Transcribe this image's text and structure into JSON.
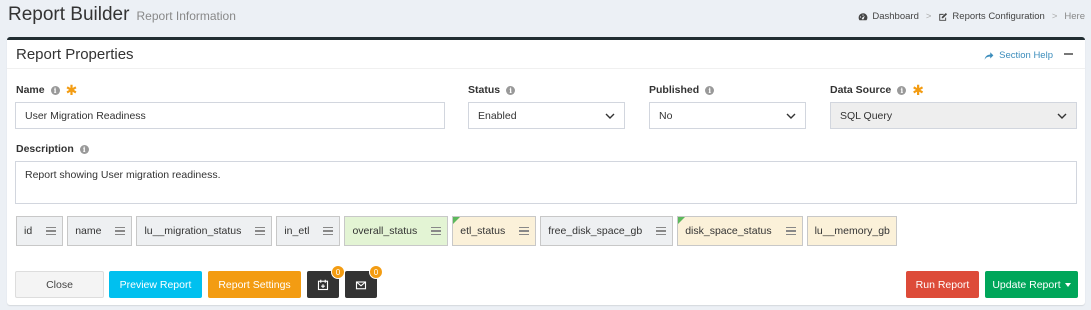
{
  "header": {
    "title": "Report Builder",
    "subtitle": "Report Information"
  },
  "breadcrumb": {
    "items": [
      "Dashboard",
      "Reports Configuration",
      "Here"
    ]
  },
  "panel": {
    "title": "Report Properties",
    "help_label": "Section Help"
  },
  "form": {
    "name": {
      "label": "Name",
      "value": "User Migration Readiness"
    },
    "status": {
      "label": "Status",
      "value": "Enabled"
    },
    "published": {
      "label": "Published",
      "value": "No"
    },
    "data_source": {
      "label": "Data Source",
      "value": "SQL Query"
    },
    "description": {
      "label": "Description",
      "value": "Report showing User migration readiness."
    }
  },
  "fields": [
    {
      "label": "id",
      "style": "default"
    },
    {
      "label": "name",
      "style": "default"
    },
    {
      "label": "lu__migration_status",
      "style": "default"
    },
    {
      "label": "in_etl",
      "style": "default"
    },
    {
      "label": "overall_status",
      "style": "green"
    },
    {
      "label": "etl_status",
      "style": "yellow-flag"
    },
    {
      "label": "free_disk_space_gb",
      "style": "default"
    },
    {
      "label": "disk_space_status",
      "style": "yellow-flag"
    },
    {
      "label": "lu__memory_gb",
      "style": "yellow"
    }
  ],
  "actions": {
    "close": "Close",
    "preview": "Preview Report",
    "settings": "Report Settings",
    "schedule_count": "0",
    "email_count": "0",
    "run": "Run Report",
    "update": "Update Report"
  },
  "colors": {
    "accent_info": "#00c0ef",
    "accent_warning": "#f39c12",
    "danger": "#dd4b39",
    "success": "#00a65a",
    "field_green": "#e3f4d4",
    "field_yellow": "#fbf1d9"
  }
}
